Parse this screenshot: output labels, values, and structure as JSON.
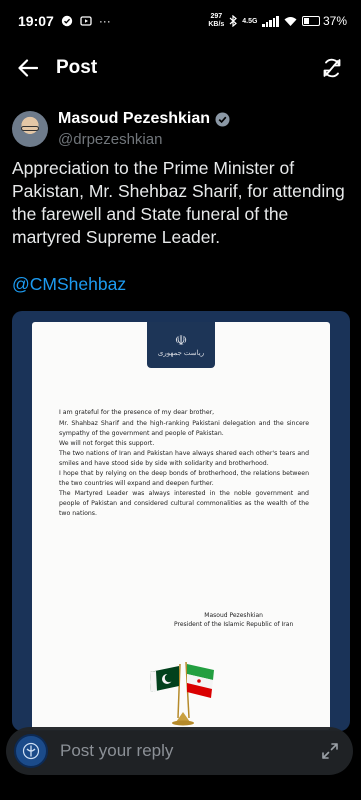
{
  "status_bar": {
    "time": "19:07",
    "net_speed_value": "297",
    "net_speed_unit": "KB/s",
    "network_type": "4.5G",
    "battery": "37%"
  },
  "header": {
    "title": "Post"
  },
  "post": {
    "author_name": "Masoud Pezeshkian",
    "author_handle": "@drpezeshkian",
    "text": "Appreciation to the Prime Minister of Pakistan, Mr. Shehbaz Sharif, for attending the farewell and State funeral of the martyred Supreme Leader.",
    "mention": "@CMShehbaz"
  },
  "letter": {
    "paragraphs": [
      "I am grateful for the presence of my dear brother,",
      "Mr. Shahbaz Sharif and the high-ranking Pakistani delegation and the sincere sympathy of the government and people of Pakistan.",
      "We will not forget this support.",
      "The two nations of Iran and Pakistan have always shared each other's tears and smiles and have stood side by side with solidarity and brotherhood.",
      "I hope that by relying on the deep bonds of brotherhood, the relations between the two countries will expand and deepen further.",
      "The Martyred Leader was always interested in the noble government and people of Pakistan and considered cultural commonalities as the wealth of the two nations."
    ],
    "signature_name": "Masoud Pezeshkian",
    "signature_title": "President of the Islamic Republic of Iran",
    "emblem_caption": "ریاست جمهوری"
  },
  "reply": {
    "placeholder": "Post your reply"
  },
  "colors": {
    "background": "#000000",
    "link": "#1d9bf0",
    "verified": "#8b98a5",
    "media_frame": "#1a3358",
    "secondary_text": "#71767b"
  },
  "icons": {
    "back": "arrow-left-icon",
    "refresh": "refresh-icon",
    "verified": "verified-badge-icon",
    "expand": "expand-icon"
  }
}
